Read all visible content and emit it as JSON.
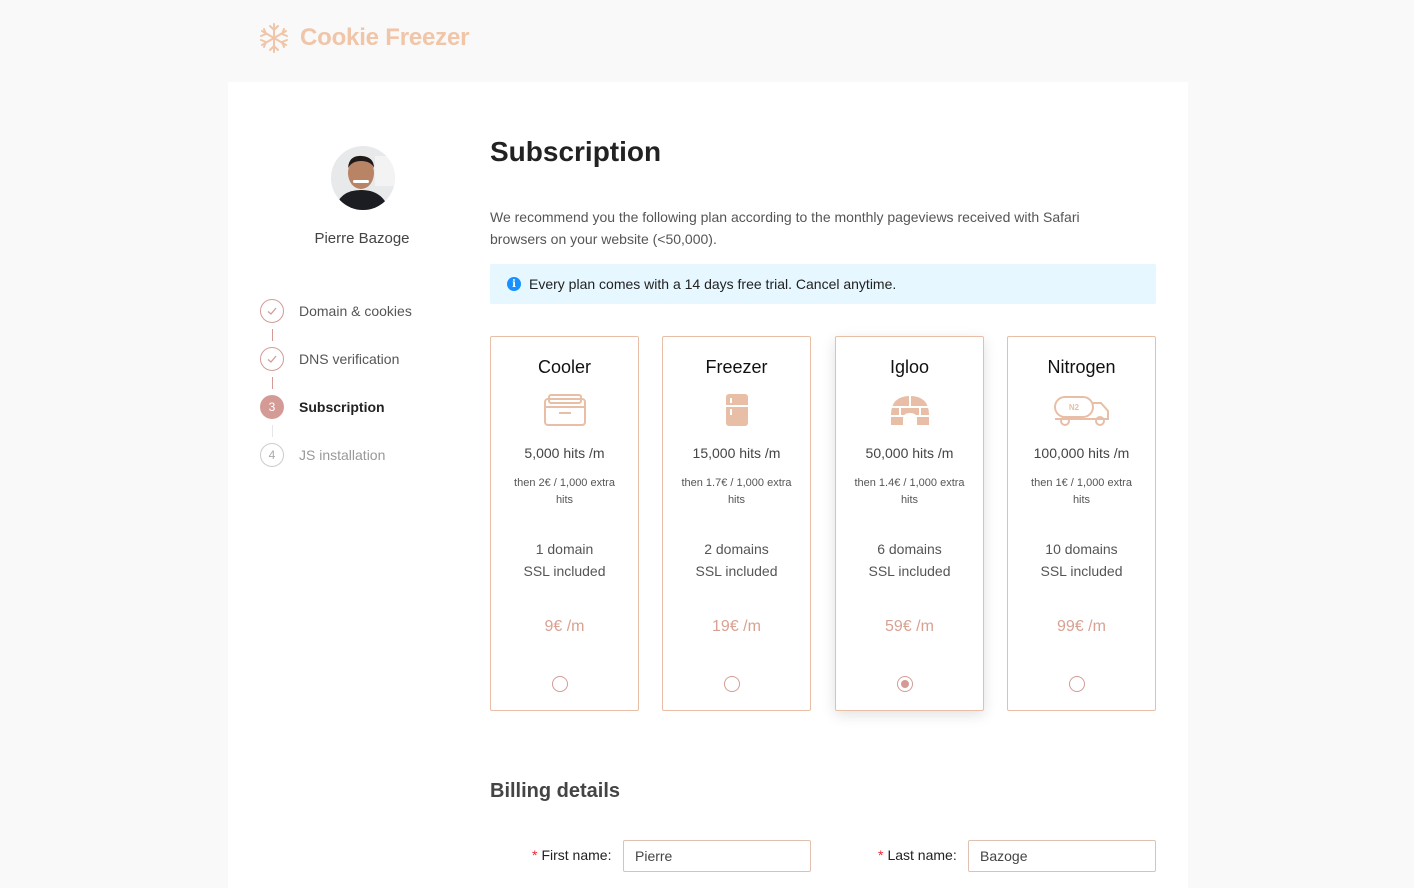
{
  "brand": {
    "name": "Cookie Freezer",
    "logo_icon": "snowflake-icon",
    "color": "#f0c5a8"
  },
  "user": {
    "name": "Pierre Bazoge",
    "avatar_icon": "user-photo"
  },
  "steps": [
    {
      "label": "Domain & cookies",
      "status": "done",
      "marker": "✓"
    },
    {
      "label": "DNS verification",
      "status": "done",
      "marker": "✓"
    },
    {
      "label": "Subscription",
      "status": "active",
      "marker": "3"
    },
    {
      "label": "JS installation",
      "status": "todo",
      "marker": "4"
    }
  ],
  "page": {
    "title": "Subscription",
    "intro": "We recommend you the following plan according to the monthly pageviews received with Safari browsers on your website (<50,000).",
    "alert": "Every plan comes with a 14 days free trial. Cancel anytime.",
    "alert_icon": "info-icon"
  },
  "plans": [
    {
      "name": "Cooler",
      "icon": "cooler-icon",
      "hits": "5,000 hits /m",
      "extra": "then 2€ / 1,000 extra hits",
      "domains": "1 domain",
      "ssl": "SSL included",
      "price": "9€ /m",
      "selected": false
    },
    {
      "name": "Freezer",
      "icon": "fridge-icon",
      "hits": "15,000 hits /m",
      "extra": "then 1.7€ / 1,000 extra hits",
      "domains": "2 domains",
      "ssl": "SSL included",
      "price": "19€ /m",
      "selected": false
    },
    {
      "name": "Igloo",
      "icon": "igloo-icon",
      "hits": "50,000 hits /m",
      "extra": "then 1.4€ / 1,000 extra hits",
      "domains": "6 domains",
      "ssl": "SSL included",
      "price": "59€ /m",
      "selected": true
    },
    {
      "name": "Nitrogen",
      "icon": "n2-truck-icon",
      "hits": "100,000 hits /m",
      "extra": "then 1€ / 1,000 extra hits",
      "domains": "10 domains",
      "ssl": "SSL included",
      "price": "99€ /m",
      "selected": false,
      "icon_text": "N2"
    }
  ],
  "billing": {
    "title": "Billing details",
    "first_name": {
      "label": "First name",
      "value": "Pierre",
      "required_mark": "*"
    },
    "last_name": {
      "label": "Last name",
      "value": "Bazoge",
      "required_mark": "*"
    }
  },
  "colors": {
    "accent": "#d49b96",
    "price": "#d9a192",
    "border": "#e8bfa6",
    "alert_bg": "#e6f7ff",
    "info": "#1890ff"
  }
}
